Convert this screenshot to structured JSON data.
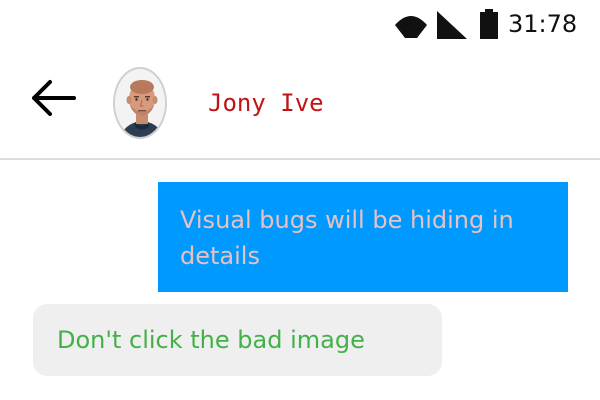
{
  "status_bar": {
    "time": "31:78",
    "icons": [
      "wifi-icon",
      "signal-icon",
      "battery-icon"
    ]
  },
  "header": {
    "back_icon": "arrow-left-icon",
    "contact_name": "Jony Ive",
    "name_color": "#c01414"
  },
  "messages": [
    {
      "direction": "outgoing",
      "text": "Visual bugs will be hiding in details",
      "bg": "#0099ff",
      "color": "#eac1c1"
    },
    {
      "direction": "incoming",
      "text": "Don't click the bad image",
      "bg": "#efefef",
      "color": "#43b04a"
    }
  ]
}
